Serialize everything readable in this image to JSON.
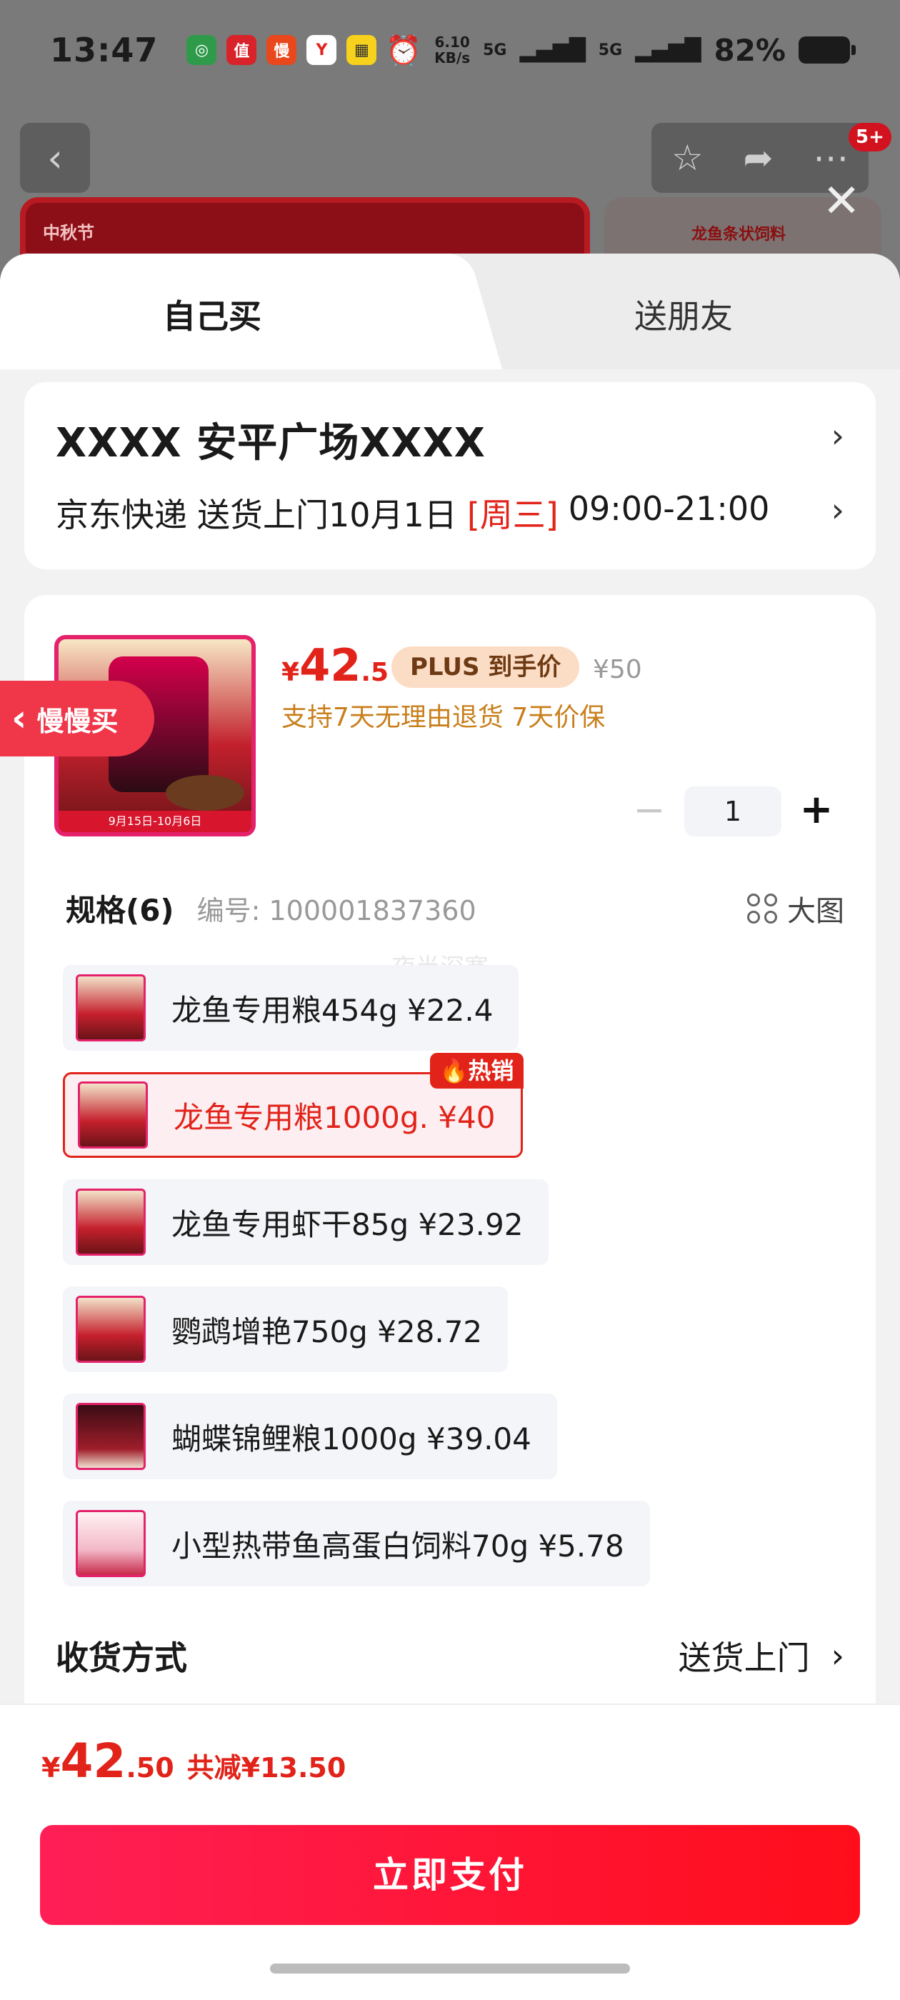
{
  "status_bar": {
    "time": "13:47",
    "net_speed": "6.10\nKB/s",
    "signal1": "5G",
    "signal2": "5G",
    "battery": "82%"
  },
  "background": {
    "badge": "5+",
    "banner_tag": "中秋节",
    "banner_right_text": "龙鱼条状饲料"
  },
  "tabs": {
    "self": "自己买",
    "friend": "送朋友"
  },
  "address": {
    "line1": "XXXX  安平广场XXXX",
    "carrier": "京东快递",
    "delivery": "送货上门10月1日",
    "weekday": "[周三]",
    "time_range": "09:00-21:00"
  },
  "product": {
    "thumb_date": "9月15日-10月6日",
    "price_yen": "¥",
    "price_int": "42",
    "price_dec": ".5",
    "plus_tag": "PLUS 到手价",
    "orig_price": "¥50",
    "guarantee": "支持7天无理由退货  7天价保",
    "quantity": "1",
    "minus": "−",
    "plus": "+"
  },
  "slow_buy": {
    "label": "慢慢买",
    "arrow": "‹"
  },
  "spec": {
    "title": "规格(6)",
    "sku": "编号: 100001837360",
    "big_image": "大图",
    "watermark": "夜半深寒"
  },
  "variants": [
    {
      "label": "龙鱼专用粮454g  ¥22.4",
      "selected": false
    },
    {
      "label": "龙鱼专用粮1000g.  ¥40",
      "selected": true,
      "badge": "🔥热销"
    },
    {
      "label": "龙鱼专用虾干85g  ¥23.92",
      "selected": false
    },
    {
      "label": "鹦鹉增艳750g  ¥28.72",
      "selected": false
    },
    {
      "label": "蝴蝶锦鲤粮1000g  ¥39.04",
      "selected": false
    },
    {
      "label": "小型热带鱼高蛋白饲料70g  ¥5.78",
      "selected": false
    }
  ],
  "delivery": {
    "label": "收货方式",
    "value": "送货上门"
  },
  "footer": {
    "total_yen": "¥",
    "total_int": "42",
    "total_dec": ".50",
    "savings": "共减¥13.50",
    "pay_button": "立即支付"
  },
  "colors": {
    "accent": "#e2231a",
    "pay_gradient_start": "#ff1f56",
    "pay_gradient_end": "#ff0d1a"
  }
}
